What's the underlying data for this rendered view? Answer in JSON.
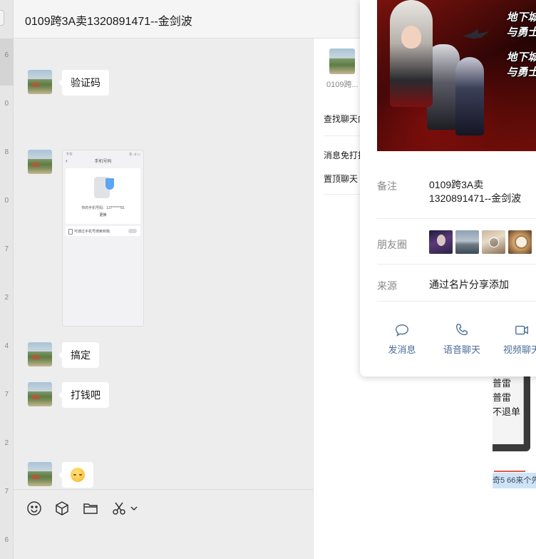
{
  "window": {
    "title": "0109跨3A卖1320891471--金剑波"
  },
  "left_strip": {
    "numbers": [
      "6",
      "0",
      "8",
      "0",
      "7",
      "2",
      "4",
      "7",
      "2",
      "7",
      "6"
    ]
  },
  "messages": [
    {
      "type": "text",
      "text": "验证码"
    },
    {
      "type": "image",
      "caption": "phone-verification-screenshot"
    },
    {
      "type": "text",
      "text": "搞定"
    },
    {
      "type": "text",
      "text": "打钱吧"
    },
    {
      "type": "emoji",
      "emoji": "smiling-face"
    }
  ],
  "phone_screenshot": {
    "status_left": "下午",
    "status_right": "令 .ıl ▭",
    "nav_title": "手机号码",
    "phone_line": "你的手机号码：137******81",
    "change_link": "更换",
    "toggle_text": "可通过手机号搜索到我"
  },
  "toolbar": {
    "icons": [
      "emoji-icon",
      "cube-icon",
      "folder-icon",
      "scissors-icon",
      "chevron-down-icon"
    ]
  },
  "info_panel": {
    "member_name": "0109跨...",
    "find_history": "查找聊天内",
    "mute": "消息免打扰",
    "pin": "置顶聊天"
  },
  "background_window": {
    "line1": "普雷",
    "line2": "普雷",
    "line3": "不退单",
    "footer": "奇5 66来个先"
  },
  "contact_card": {
    "cover_logo_line1": "地下城与勇士",
    "cover_logo_line2": "地下城与勇士",
    "remark_label": "备注",
    "remark_value_line1": "0109跨3A卖",
    "remark_value_line2": "1320891471--金剑波",
    "moments_label": "朋友圈",
    "source_label": "来源",
    "source_value": "通过名片分享添加",
    "actions": [
      {
        "label": "发消息",
        "icon": "chat-bubble-icon"
      },
      {
        "label": "语音聊天",
        "icon": "phone-icon"
      },
      {
        "label": "视频聊天",
        "icon": "video-icon"
      }
    ],
    "accent_color": "#4a6d98"
  }
}
